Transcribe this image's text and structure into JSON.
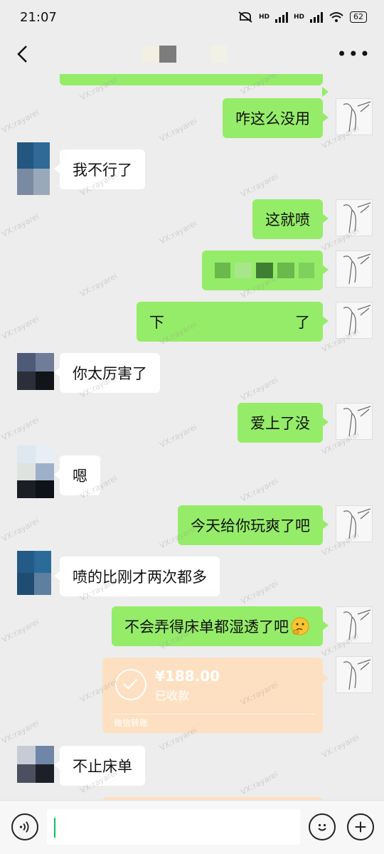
{
  "status_bar": {
    "time": "21:07",
    "network_label_1": "HD",
    "network_label_2": "HD",
    "battery": "62"
  },
  "header": {
    "back_icon": "chevron-left-icon",
    "more_icon": "more-dots-icon",
    "title_obscured": true
  },
  "messages": [
    {
      "id": "m0",
      "side": "me",
      "text": "",
      "partial": true
    },
    {
      "id": "m1",
      "side": "me",
      "text": "咋这么没用"
    },
    {
      "id": "m2",
      "side": "other",
      "text": "我不行了"
    },
    {
      "id": "m3",
      "side": "me",
      "text": "这就喷"
    },
    {
      "id": "m4",
      "side": "me",
      "text": "",
      "obscured": true
    },
    {
      "id": "m5",
      "side": "me",
      "text_start": "下",
      "text_end": "了",
      "obscured": true
    },
    {
      "id": "m6",
      "side": "other",
      "text": "你太厉害了"
    },
    {
      "id": "m7",
      "side": "me",
      "text": "爱上了没"
    },
    {
      "id": "m8",
      "side": "other",
      "text": "嗯"
    },
    {
      "id": "m9",
      "side": "me",
      "text": "今天给你玩爽了吧"
    },
    {
      "id": "m10",
      "side": "other",
      "text": "喷的比刚才两次都多"
    },
    {
      "id": "m11",
      "side": "me",
      "text": "不会弄得床单都湿透了吧",
      "emoji": "thinking-face-emoji"
    },
    {
      "id": "m12",
      "side": "me",
      "type": "transfer",
      "amount": "¥188.00",
      "status": "已收款",
      "footer": "微信转账"
    },
    {
      "id": "m13",
      "side": "other",
      "text": "不止床单"
    }
  ],
  "watermark": "VX:rayarei",
  "input_bar": {
    "voice_icon": "voice-icon",
    "emoji_icon": "smile-icon",
    "plus_icon": "plus-icon",
    "placeholder": ""
  },
  "colors": {
    "background": "#ededed",
    "my_bubble": "#95ec69",
    "other_bubble": "#ffffff",
    "transfer": "#fde0c1",
    "caret": "#07c160"
  }
}
